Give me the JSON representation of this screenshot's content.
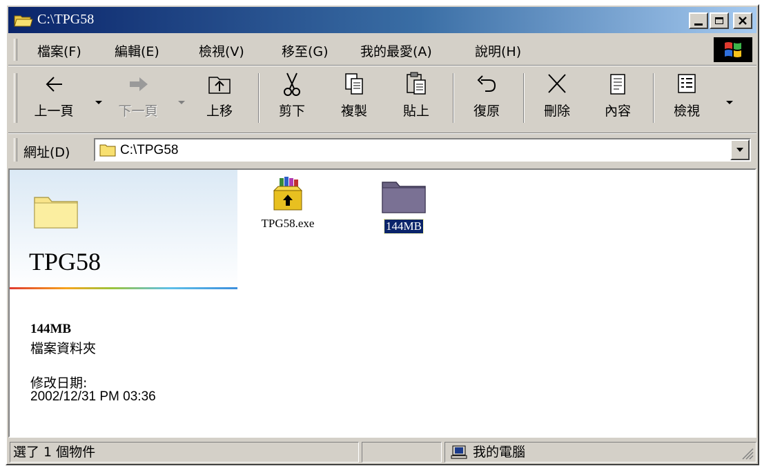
{
  "window": {
    "title": "C:\\TPG58",
    "controls": {
      "minimize_icon": "minimize-icon",
      "maximize_icon": "maximize-icon",
      "close_icon": "close-icon"
    }
  },
  "menu": {
    "items": [
      {
        "label": "檔案(F)"
      },
      {
        "label": "編輯(E)"
      },
      {
        "label": "檢視(V)"
      },
      {
        "label": "移至(G)"
      },
      {
        "label": "我的最愛(A)"
      },
      {
        "label": "說明(H)"
      }
    ]
  },
  "toolbar": {
    "back": "上一頁",
    "forward": "下一頁",
    "up": "上移",
    "cut": "剪下",
    "copy": "複製",
    "paste": "貼上",
    "undo": "復原",
    "delete": "刪除",
    "properties": "內容",
    "views": "檢視"
  },
  "address": {
    "label": "網址(D)",
    "value": "C:\\TPG58"
  },
  "webview": {
    "folder_title": "TPG58",
    "selected_name": "144MB",
    "selected_type": "檔案資料夾",
    "modified_label": "修改日期:",
    "modified_value": "2002/12/31 PM 03:36"
  },
  "files": [
    {
      "name": "TPG58.exe",
      "icon": "winrar-sfx-icon",
      "selected": false
    },
    {
      "name": "144MB",
      "icon": "folder-icon",
      "selected": true
    }
  ],
  "status": {
    "selection": "選了 1 個物件",
    "location": "我的電腦"
  },
  "colors": {
    "title_bar_start": "#0a246a",
    "title_bar_end": "#a6caf0",
    "face": "#d4d0c8",
    "selection": "#0a246a"
  }
}
